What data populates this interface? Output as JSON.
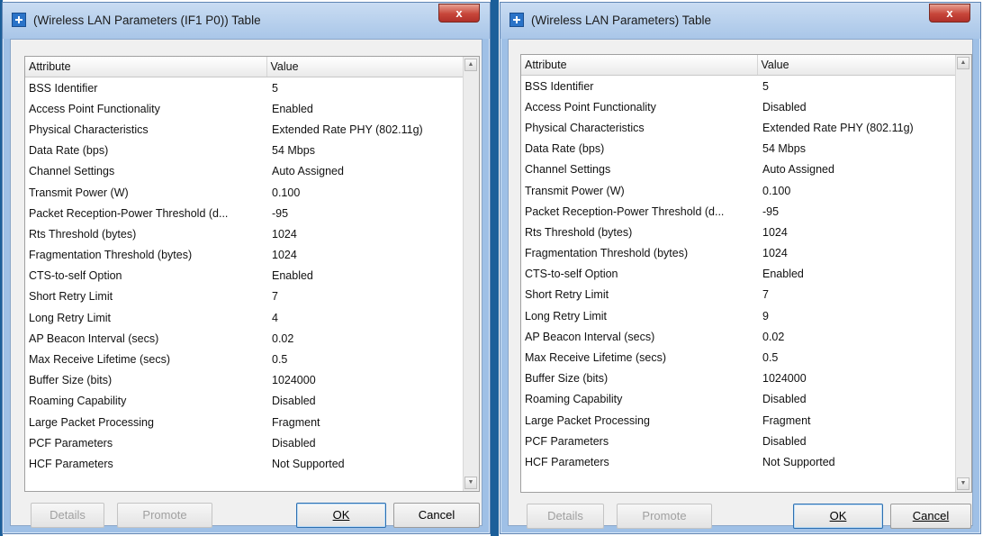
{
  "columns": {
    "attribute": "Attribute",
    "value": "Value"
  },
  "buttons": {
    "details": "Details",
    "promote": "Promote",
    "ok": "OK",
    "cancel": "Cancel"
  },
  "close_glyph": "x",
  "colors": {
    "title_bar": "#b8d1ee",
    "close": "#c7463a",
    "frame_seam": "#1c5f9a"
  },
  "windows": [
    {
      "title": "(Wireless LAN Parameters (IF1 P0)) Table",
      "rows": [
        {
          "attr": "BSS Identifier",
          "val": "5"
        },
        {
          "attr": "Access Point Functionality",
          "val": "Enabled"
        },
        {
          "attr": "Physical Characteristics",
          "val": "Extended Rate PHY (802.11g)"
        },
        {
          "attr": "Data Rate (bps)",
          "val": "54 Mbps"
        },
        {
          "attr": "Channel Settings",
          "val": "Auto Assigned"
        },
        {
          "attr": "Transmit Power (W)",
          "val": "0.100"
        },
        {
          "attr": "Packet Reception-Power Threshold (d...",
          "val": "-95"
        },
        {
          "attr": "Rts Threshold (bytes)",
          "val": "1024"
        },
        {
          "attr": "Fragmentation Threshold (bytes)",
          "val": "1024"
        },
        {
          "attr": "CTS-to-self Option",
          "val": "Enabled"
        },
        {
          "attr": "Short Retry Limit",
          "val": "7"
        },
        {
          "attr": "Long Retry Limit",
          "val": "4"
        },
        {
          "attr": "AP Beacon Interval (secs)",
          "val": "0.02"
        },
        {
          "attr": "Max Receive Lifetime (secs)",
          "val": "0.5"
        },
        {
          "attr": "Buffer Size (bits)",
          "val": "1024000"
        },
        {
          "attr": "Roaming Capability",
          "val": "Disabled"
        },
        {
          "attr": "Large Packet Processing",
          "val": "Fragment"
        },
        {
          "attr": "PCF Parameters",
          "val": "Disabled"
        },
        {
          "attr": "HCF Parameters",
          "val": "Not Supported"
        }
      ]
    },
    {
      "title": "(Wireless LAN Parameters) Table",
      "rows": [
        {
          "attr": "BSS Identifier",
          "val": "5"
        },
        {
          "attr": "Access Point Functionality",
          "val": "Disabled"
        },
        {
          "attr": "Physical Characteristics",
          "val": "Extended Rate PHY (802.11g)"
        },
        {
          "attr": "Data Rate (bps)",
          "val": "54 Mbps"
        },
        {
          "attr": "Channel Settings",
          "val": "Auto Assigned"
        },
        {
          "attr": "Transmit Power (W)",
          "val": "0.100"
        },
        {
          "attr": "Packet Reception-Power Threshold (d...",
          "val": "-95"
        },
        {
          "attr": "Rts Threshold (bytes)",
          "val": "1024"
        },
        {
          "attr": "Fragmentation Threshold (bytes)",
          "val": "1024"
        },
        {
          "attr": "CTS-to-self Option",
          "val": "Enabled"
        },
        {
          "attr": "Short Retry Limit",
          "val": "7"
        },
        {
          "attr": "Long Retry Limit",
          "val": "9"
        },
        {
          "attr": "AP Beacon Interval (secs)",
          "val": "0.02"
        },
        {
          "attr": "Max Receive Lifetime (secs)",
          "val": "0.5"
        },
        {
          "attr": "Buffer Size (bits)",
          "val": "1024000"
        },
        {
          "attr": "Roaming Capability",
          "val": "Disabled"
        },
        {
          "attr": "Large Packet Processing",
          "val": "Fragment"
        },
        {
          "attr": "PCF Parameters",
          "val": "Disabled"
        },
        {
          "attr": "HCF Parameters",
          "val": "Not Supported"
        }
      ]
    }
  ]
}
